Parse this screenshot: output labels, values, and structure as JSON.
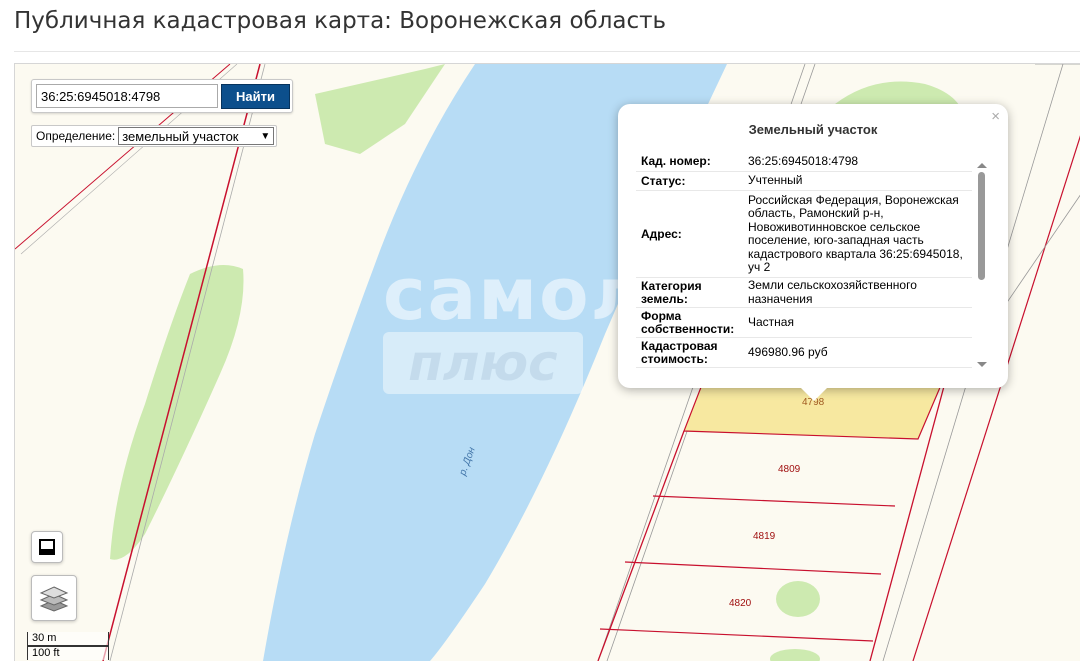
{
  "page": {
    "title": "Публичная кадастровая карта: Воронежская область"
  },
  "search": {
    "value": "36:25:6945018:4798",
    "button_label": "Найти"
  },
  "definition": {
    "label": "Определение:",
    "selected": "земельный участок"
  },
  "map": {
    "river_label": "р. Дон",
    "parcels": [
      {
        "id": "4798"
      },
      {
        "id": "4809"
      },
      {
        "id": "4819"
      },
      {
        "id": "4820"
      }
    ],
    "scale": {
      "metric": "30 m",
      "imperial": "100 ft"
    },
    "watermark": {
      "line1": "самолёт",
      "line2": "плюс"
    }
  },
  "popup": {
    "close": "×",
    "title": "Земельный участок",
    "rows": [
      {
        "key": "Кад. номер:",
        "value": "36:25:6945018:4798"
      },
      {
        "key": "Статус:",
        "value": "Учтенный"
      },
      {
        "key": "Адрес:",
        "value": "Российская Федерация, Воронежская область, Рамонский р-н, Новоживотинновское сельское поселение, юго-западная часть кадастрового квартала 36:25:6945018, уч 2"
      },
      {
        "key": "Категория земель:",
        "value": "Земли сельскохозяйственного назначения"
      },
      {
        "key": "Форма собственности:",
        "value": "Частная"
      },
      {
        "key": "Кадастровая стоимость:",
        "value": "496980.96 руб"
      }
    ]
  },
  "colors": {
    "water": "#b7dcf5",
    "vegetation": "#cdeab0",
    "parcel_selected": "#f7e8a0",
    "boundary": "#c8102e",
    "button": "#0c4f8c"
  }
}
